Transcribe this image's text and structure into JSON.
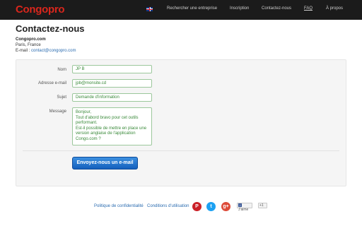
{
  "header": {
    "logo": "Congopro",
    "nav": [
      "Rechercher une entreprise",
      "Inscription",
      "Contactez-nous",
      "FAQ",
      "À propos"
    ],
    "language_flag": "uk-flag-icon"
  },
  "page": {
    "title": "Contactez-nous",
    "company": "Congopro.com",
    "city": "Paris, France",
    "email_label": "E-mail :",
    "email_value": "contact@congopro.com"
  },
  "form": {
    "name_label": "Nom",
    "name_value": "JP B",
    "email_label": "Adresse e-mail",
    "email_value": "jpb@monsite.cd",
    "subject_label": "Sujet",
    "subject_value": "Demande d'information",
    "message_label": "Message",
    "message_value": "Bonjour,\nTout d'abord bravo pour cet outils\nperformant.\nEst-il possible de mettre en place une\nversion anglaise de l'application\nCongo.com ?",
    "submit_label": "Envoyez-nous un e-mail"
  },
  "footer": {
    "privacy": "Politique de confidentialité",
    "terms": "Conditions d'utilisation",
    "social": [
      "pinterest-icon",
      "twitter-icon",
      "google-plus-icon"
    ],
    "like_label": "J'aime",
    "plus_label": "+1"
  },
  "colors": {
    "brand": "#d9261c",
    "topbar": "#1b1b1b",
    "button": "#1560bd",
    "link": "#2b6cb0",
    "pinterest": "#cb2027",
    "twitter": "#1da1f2",
    "google": "#dd4b39"
  }
}
